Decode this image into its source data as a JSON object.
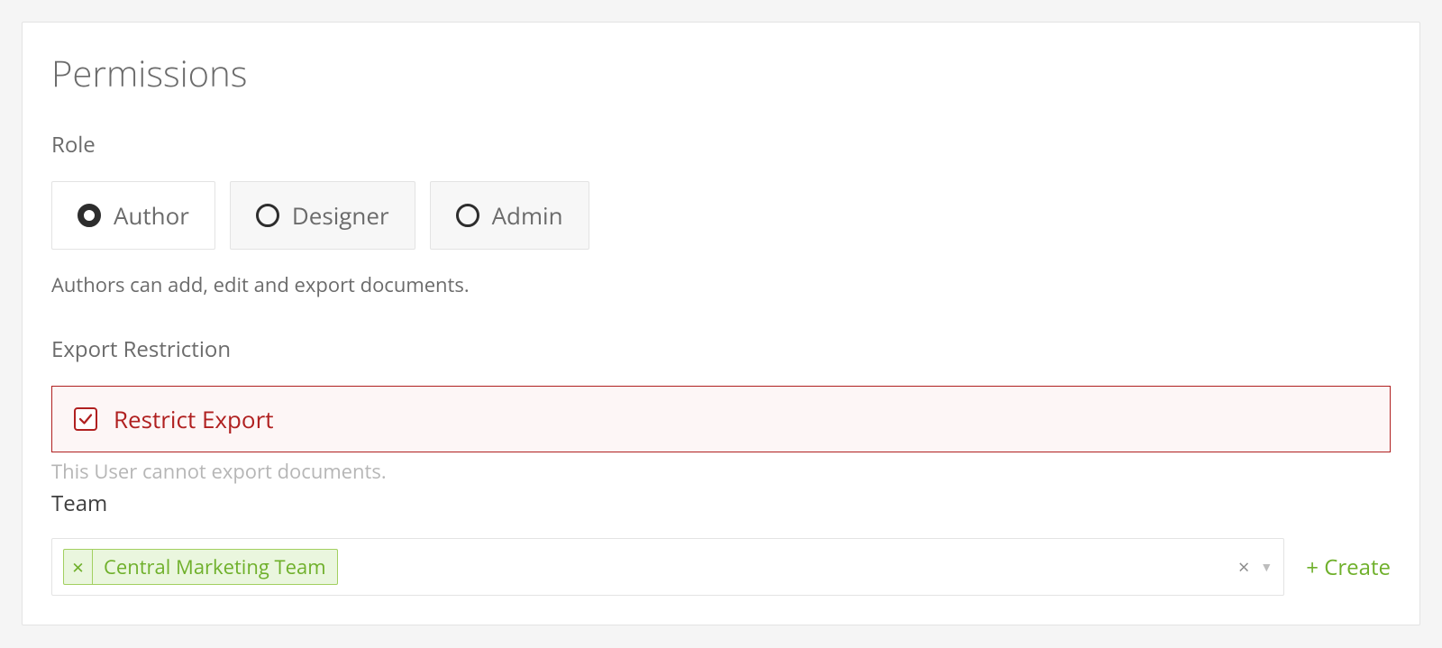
{
  "title": "Permissions",
  "sections": {
    "role": {
      "label": "Role",
      "options": [
        {
          "label": "Author",
          "selected": true
        },
        {
          "label": "Designer",
          "selected": false
        },
        {
          "label": "Admin",
          "selected": false
        }
      ],
      "description": "Authors can add, edit and export documents."
    },
    "export_restriction": {
      "label": "Export Restriction",
      "checkbox_label": "Restrict Export",
      "checkbox_checked": true,
      "description": "This User cannot export documents."
    },
    "team": {
      "label": "Team",
      "selected_chips": [
        {
          "label": "Central Marketing Team"
        }
      ],
      "create_label": "+ Create"
    }
  }
}
